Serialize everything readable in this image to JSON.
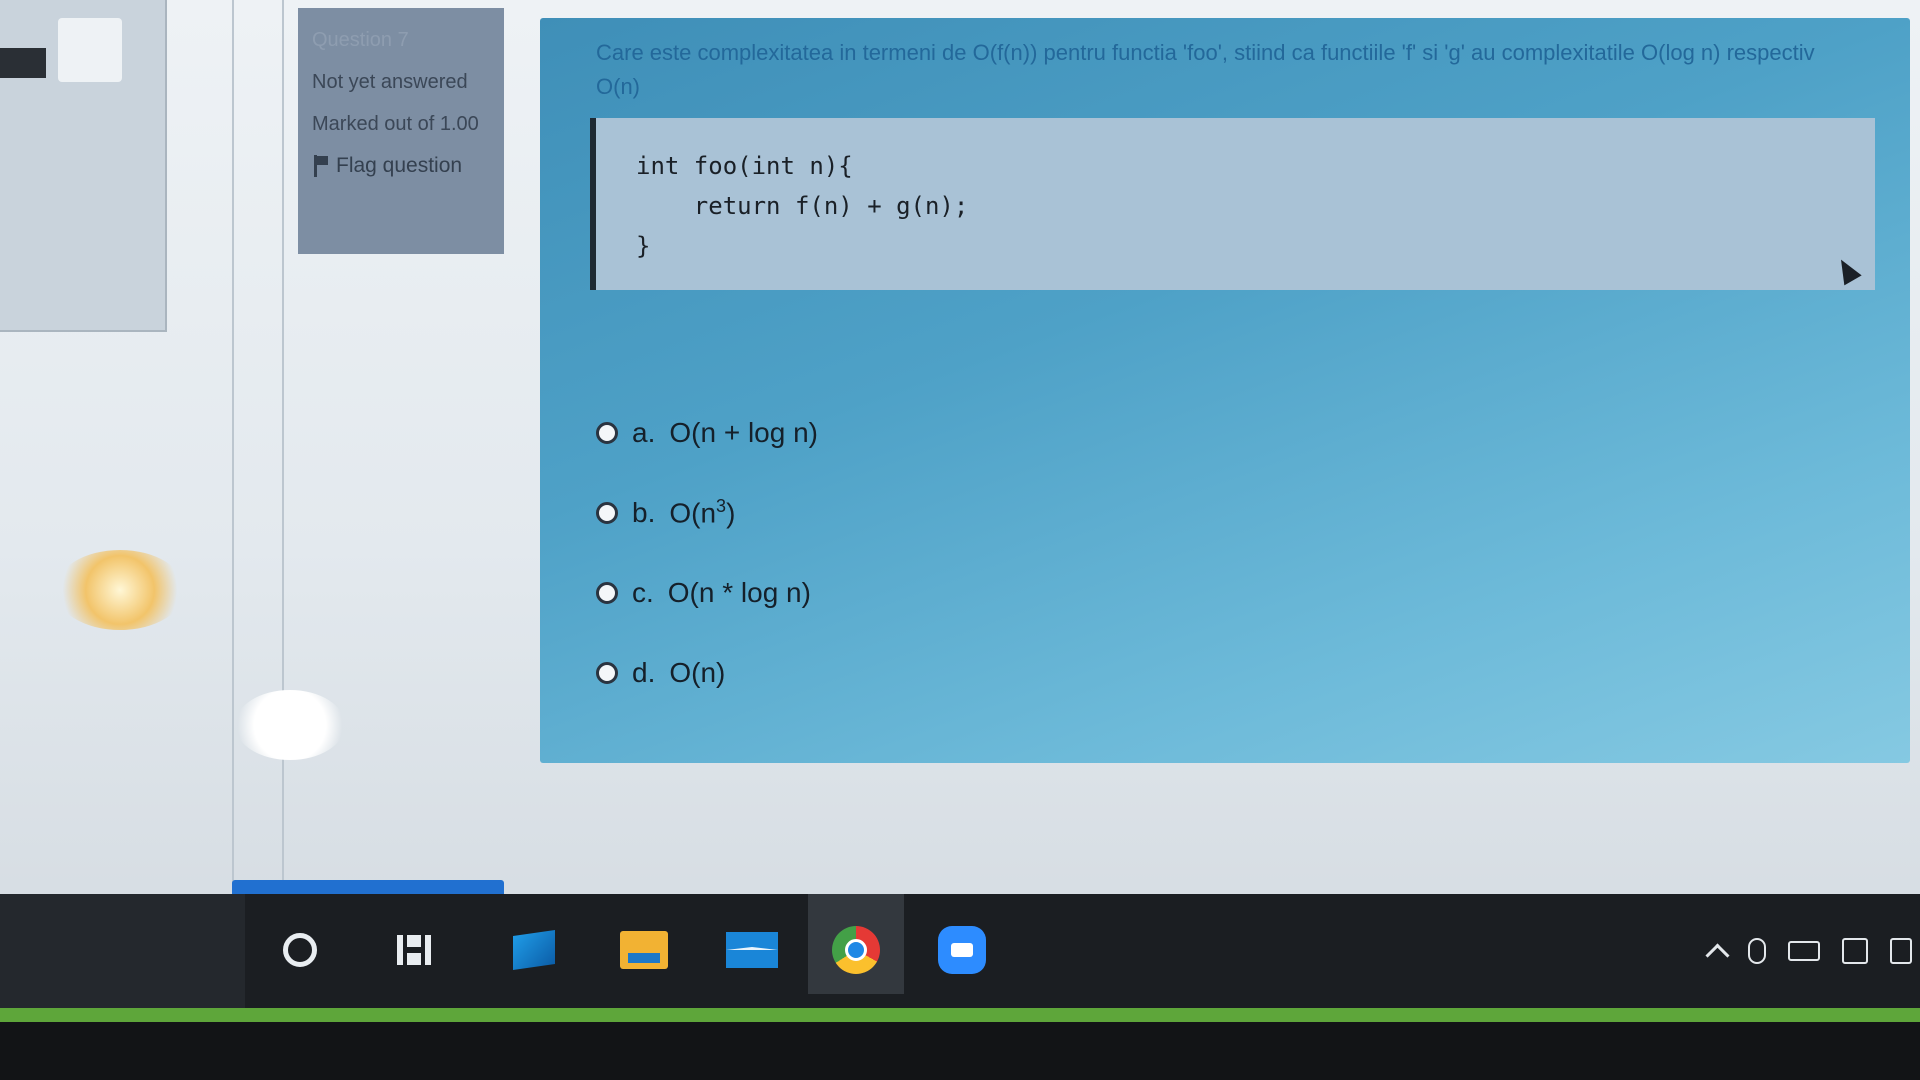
{
  "question_info": {
    "question_label": "Question 7",
    "status": "Not yet answered",
    "marked": "Marked out of 1.00",
    "flag_label": "Flag question"
  },
  "question": {
    "text": "Care este complexitatea in termeni de O(f(n)) pentru functia 'foo', stiind ca functiile 'f' si 'g' au complexitatile O(log n) respectiv O(n)",
    "code_lines": [
      "int foo(int n){",
      "    return f(n) + g(n);",
      "}"
    ],
    "answers": [
      {
        "letter": "a.",
        "text": "O(n + log n)"
      },
      {
        "letter": "b.",
        "text": "O(n",
        "sup": "3",
        "suffix": ")"
      },
      {
        "letter": "c.",
        "text": "O(n * log n)"
      },
      {
        "letter": "d.",
        "text": "O(n)"
      }
    ]
  },
  "taskbar": {
    "icons": [
      "cortana-icon",
      "task-view-icon",
      "this-pc-icon",
      "file-explorer-icon",
      "mail-icon",
      "chrome-icon",
      "zoom-icon"
    ],
    "tray_icons": [
      "show-hidden-icons-chevron",
      "microphone-icon",
      "battery-icon",
      "network-icon",
      "volume-icon"
    ]
  },
  "colors": {
    "card_start": "#3f8fb8",
    "card_end": "#85c9e2",
    "info_panel": "#7d8ea3",
    "taskbar": "#1b1e22",
    "accent_green": "#5ea63a",
    "accent_blue": "#2170d0"
  }
}
